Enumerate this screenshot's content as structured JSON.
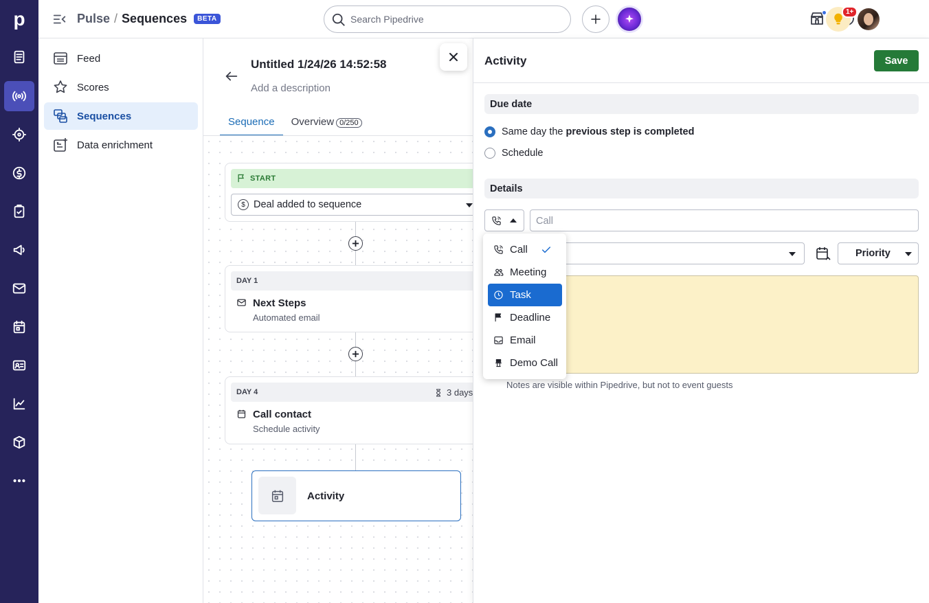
{
  "app": {
    "logo_letter": "p",
    "breadcrumb": {
      "parent": "Pulse",
      "separator": "/",
      "current": "Sequences",
      "badge": "BETA"
    },
    "search_placeholder": "Search Pipedrive",
    "notification_badge": "1+"
  },
  "rail_icons": [
    "leads-icon",
    "pulse-icon",
    "target-icon",
    "deals-icon",
    "activities-icon",
    "campaigns-icon",
    "mail-icon",
    "calendar-icon",
    "contacts-icon",
    "insights-icon",
    "products-icon",
    "more-icon"
  ],
  "subnav": {
    "items": [
      {
        "label": "Feed",
        "icon": "feed-icon",
        "active": false
      },
      {
        "label": "Scores",
        "icon": "scores-icon",
        "active": false
      },
      {
        "label": "Sequences",
        "icon": "sequences-icon",
        "active": true
      },
      {
        "label": "Data enrichment",
        "icon": "data-enrichment-icon",
        "active": false
      }
    ]
  },
  "sequence": {
    "title": "Untitled 1/24/26 14:52:58",
    "description_placeholder": "Add a description",
    "tabs": [
      {
        "label": "Sequence",
        "active": true
      },
      {
        "label": "Overview",
        "count": "0/250",
        "active": false
      }
    ],
    "start": {
      "label": "START",
      "trigger": "Deal added to sequence"
    },
    "steps": [
      {
        "day": "DAY 1",
        "title": "Next Steps",
        "subtitle": "Automated email",
        "icon": "mail-icon"
      },
      {
        "day": "DAY 4",
        "wait": "3 days",
        "title": "Call contact",
        "subtitle": "Schedule activity",
        "icon": "calendar-icon"
      }
    ],
    "pending_step": {
      "label": "Activity"
    }
  },
  "panel": {
    "title": "Activity",
    "save_label": "Save",
    "due_date": {
      "heading": "Due date",
      "option_same_day_prefix": "Same day the ",
      "option_same_day_bold": "previous step is completed",
      "option_schedule": "Schedule",
      "selected": "same_day"
    },
    "details": {
      "heading": "Details",
      "subject_placeholder": "Call",
      "priority_label": "Priority",
      "notes_hint": "Notes are visible within Pipedrive, but not to event guests"
    }
  },
  "type_dropdown": {
    "selected": "Call",
    "highlighted": "Task",
    "options": [
      {
        "label": "Call",
        "icon": "phone-icon"
      },
      {
        "label": "Meeting",
        "icon": "meeting-icon"
      },
      {
        "label": "Task",
        "icon": "clock-icon"
      },
      {
        "label": "Deadline",
        "icon": "flag-icon"
      },
      {
        "label": "Email",
        "icon": "email-tray-icon"
      },
      {
        "label": "Demo Call",
        "icon": "demo-call-icon"
      }
    ]
  },
  "colors": {
    "rail_bg": "#26235a",
    "rail_active": "#4b4fb8",
    "accent_blue": "#1a6bd0",
    "save_green": "#257a38",
    "start_green_bg": "#d7f2d6",
    "notes_bg": "#fcf1c8"
  }
}
